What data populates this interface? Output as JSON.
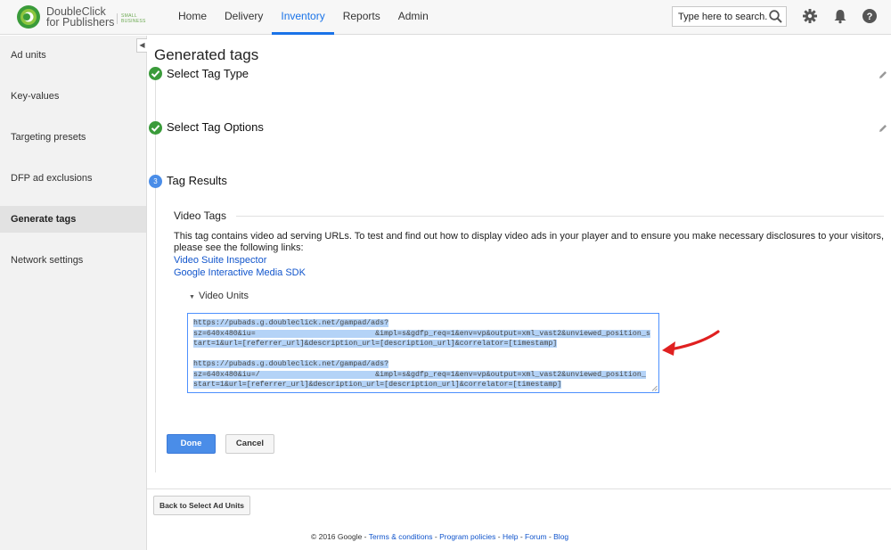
{
  "brand": {
    "line1": "DoubleClick",
    "line2": "for Publishers",
    "edition_line1": "SMALL",
    "edition_line2": "BUSINESS"
  },
  "nav": {
    "items": [
      {
        "label": "Home"
      },
      {
        "label": "Delivery"
      },
      {
        "label": "Inventory"
      },
      {
        "label": "Reports"
      },
      {
        "label": "Admin"
      }
    ],
    "active": "Inventory"
  },
  "search": {
    "placeholder": "Type here to search..."
  },
  "sidebar": {
    "items": [
      {
        "label": "Ad units"
      },
      {
        "label": "Key-values"
      },
      {
        "label": "Targeting presets"
      },
      {
        "label": "DFP ad exclusions"
      },
      {
        "label": "Generate tags"
      },
      {
        "label": "Network settings"
      }
    ],
    "active": "Generate tags",
    "collapse_glyph": "◀"
  },
  "page": {
    "title": "Generated tags",
    "steps": [
      {
        "label": "Select Tag Type",
        "state": "done"
      },
      {
        "label": "Select Tag Options",
        "state": "done"
      },
      {
        "label": "Tag Results",
        "state": "current",
        "number": "3"
      }
    ],
    "section_title": "Video Tags",
    "description": "This tag contains video ad serving URLs. To test and find out how to display video ads in your player and to ensure you make necessary disclosures to your visitors, please see the following links:",
    "links": [
      {
        "label": "Video Suite Inspector"
      },
      {
        "label": "Google Interactive Media SDK"
      }
    ],
    "units_toggle": "Video Units",
    "code_lines": [
      "https://pubads.g.doubleclick.net/gampad/ads?",
      "sz=640x480&iu=                           &impl=s&gdfp_req=1&env=vp&output=xml_vast2&unviewed_position_s",
      "tart=1&url=[referrer_url]&description_url=[description_url]&correlator=[timestamp]",
      "",
      "https://pubads.g.doubleclick.net/gampad/ads?",
      "sz=640x480&iu=/                          &impl=s&gdfp_req=1&env=vp&output=xml_vast2&unviewed_position_",
      "start=1&url=[referrer_url]&description_url=[description_url]&correlator=[timestamp]"
    ],
    "done_label": "Done",
    "cancel_label": "Cancel",
    "back_label": "Back to Select Ad Units"
  },
  "footer": {
    "copyright": "© 2016 Google",
    "sep": " - ",
    "links": [
      "Terms & conditions",
      "Program policies",
      "Help",
      "Forum",
      "Blog"
    ]
  },
  "colors": {
    "accent": "#1a73e8",
    "step_done": "#3a9b3a",
    "step_current": "#4a8de8",
    "selection": "#b4d3f7",
    "annotation_arrow": "#e02020"
  }
}
